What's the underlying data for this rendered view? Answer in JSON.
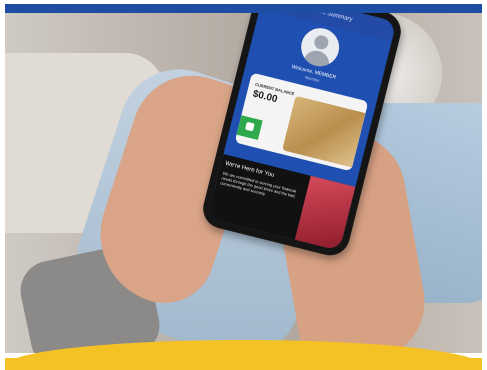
{
  "brand": {
    "top_bar_color": "#1d4ea3",
    "accent_color": "#f4c225"
  },
  "phone_screen": {
    "header_title": "Account Summary",
    "welcome_text": "Welcome, MEMBER",
    "member_type": "Member",
    "balance_label": "CURRENT BALANCE",
    "balance_value": "$0.00",
    "pay_button_icon": "payment-icon",
    "promo_title": "We're Here for You",
    "promo_body": "We are committed to serving your financial needs through the good times and the bad, conveniently and securely."
  }
}
